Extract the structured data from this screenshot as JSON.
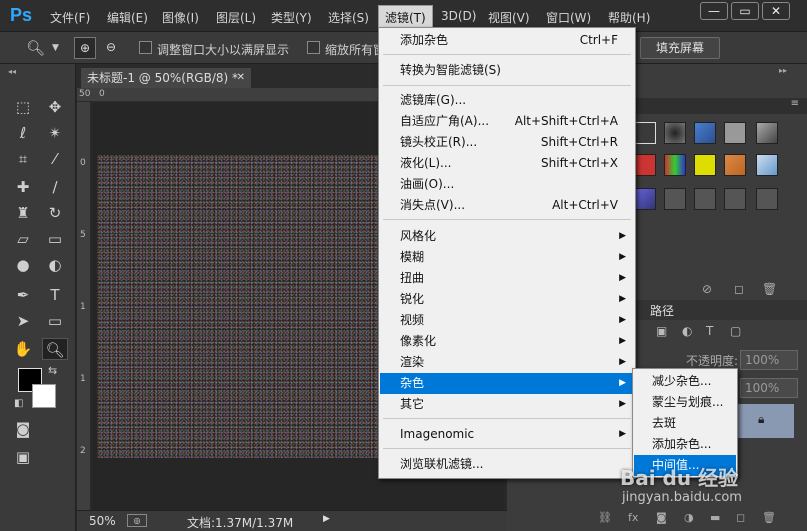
{
  "app": {
    "logo": "Ps"
  },
  "menubar": {
    "items": [
      "文件(F)",
      "编辑(E)",
      "图像(I)",
      "图层(L)",
      "类型(Y)",
      "选择(S)",
      "滤镜(T)",
      "3D(D)",
      "视图(V)",
      "窗口(W)",
      "帮助(H)"
    ],
    "active": "滤镜(T)"
  },
  "window_controls": {
    "minimize": "—",
    "restore": "▭",
    "close": "✕"
  },
  "options": {
    "resize_window": "调整窗口大小以满屏显示",
    "zoom_all": "缩放所有窗",
    "fill_screen": "填充屏幕"
  },
  "document": {
    "tab_title": "未标题-1 @ 50%(RGB/8) *",
    "ruler_top_marks": [
      "50",
      "0"
    ],
    "ruler_left_marks": [
      "0",
      "5",
      "1",
      "1",
      "2"
    ]
  },
  "status": {
    "zoom": "50%",
    "doc_info": "文档:1.37M/1.37M"
  },
  "panels": {
    "paths_tab": "路径",
    "opacity_label": "不透明度:",
    "opacity_value": "100%",
    "fill_value": "100%"
  },
  "filter_menu": {
    "items": [
      {
        "label": "添加杂色",
        "shortcut": "Ctrl+F"
      },
      {
        "label": "转换为智能滤镜(S)"
      },
      {
        "label": "滤镜库(G)..."
      },
      {
        "label": "自适应广角(A)...",
        "shortcut": "Alt+Shift+Ctrl+A"
      },
      {
        "label": "镜头校正(R)...",
        "shortcut": "Shift+Ctrl+R"
      },
      {
        "label": "液化(L)...",
        "shortcut": "Shift+Ctrl+X"
      },
      {
        "label": "油画(O)..."
      },
      {
        "label": "消失点(V)...",
        "shortcut": "Alt+Ctrl+V"
      },
      {
        "label": "风格化",
        "submenu": true
      },
      {
        "label": "模糊",
        "submenu": true
      },
      {
        "label": "扭曲",
        "submenu": true
      },
      {
        "label": "锐化",
        "submenu": true
      },
      {
        "label": "视频",
        "submenu": true
      },
      {
        "label": "像素化",
        "submenu": true
      },
      {
        "label": "渲染",
        "submenu": true
      },
      {
        "label": "杂色",
        "submenu": true,
        "highlighted": true
      },
      {
        "label": "其它",
        "submenu": true
      },
      {
        "label": "Imagenomic",
        "submenu": true
      },
      {
        "label": "浏览联机滤镜..."
      }
    ]
  },
  "noise_submenu": {
    "items": [
      {
        "label": "减少杂色..."
      },
      {
        "label": "蒙尘与划痕..."
      },
      {
        "label": "去斑"
      },
      {
        "label": "添加杂色..."
      },
      {
        "label": "中间值...",
        "highlighted": true
      }
    ]
  },
  "watermark": {
    "brand": "Bai du 经验",
    "url": "jingyan.baidu.com"
  },
  "colors": {
    "accent": "#0078d7",
    "menu_bg": "#f0f0f0",
    "app_bg": "#282828"
  }
}
